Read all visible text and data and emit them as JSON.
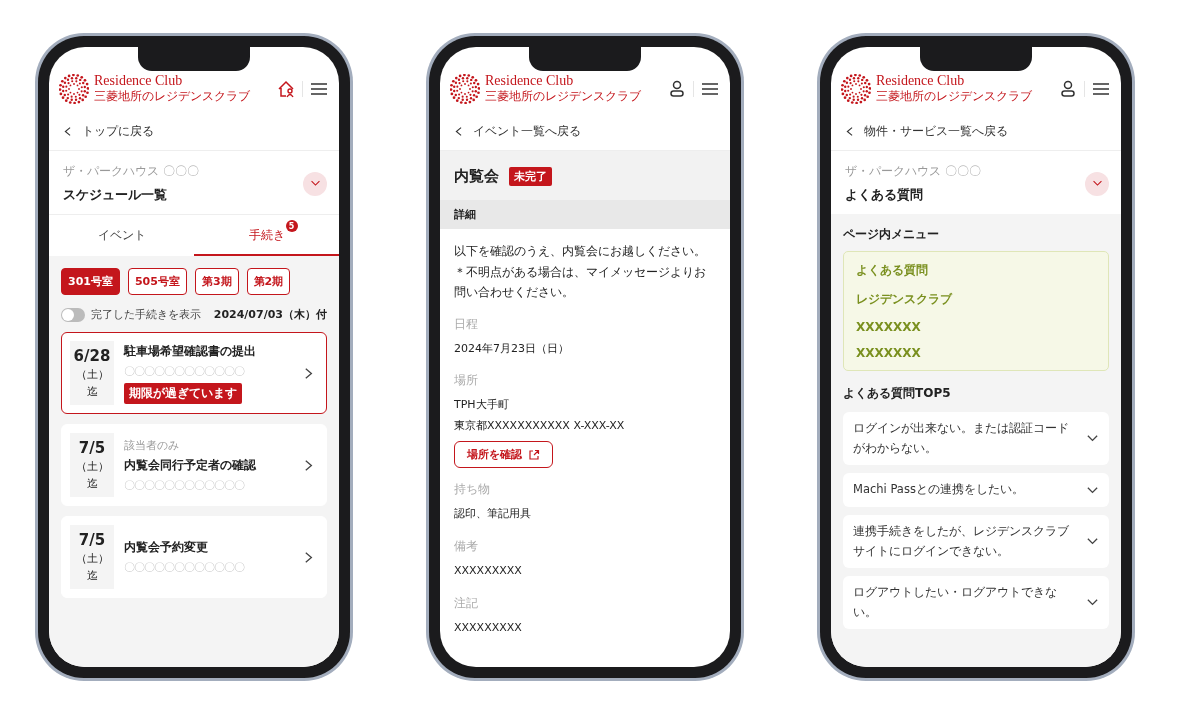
{
  "schedule_screen": {
    "brand": {
      "name": "Residence Club",
      "subtitle": "三菱地所のレジデンスクラブ"
    },
    "back_link": "トップに戻る",
    "property": "ザ・パークハウス 〇〇〇",
    "title": "スケジュール一覧",
    "expanded": false,
    "tabs": [
      {
        "label": "イベント",
        "selected": false
      },
      {
        "label": "手続き",
        "selected": true,
        "badge": "5"
      }
    ],
    "filters": [
      {
        "label": "301号室",
        "selected": true
      },
      {
        "label": "505号室",
        "selected": false
      },
      {
        "label": "第3期",
        "selected": false
      },
      {
        "label": "第2期",
        "selected": false
      }
    ],
    "show_completed": {
      "label": "完了した手続きを表示",
      "on": false
    },
    "as_of": "2024/07/03（木）付",
    "tasks": [
      {
        "date": "6/28",
        "weekday": "（土）",
        "until": "迄",
        "title": "駐車場希望確認書の提出",
        "detail": "〇〇〇〇〇〇〇〇〇〇〇〇",
        "overdue": true,
        "alert": "期限が過ぎています"
      },
      {
        "date": "7/5",
        "weekday": "（土）",
        "until": "迄",
        "note": "該当者のみ",
        "title": "内覧会同行予定者の確認",
        "detail": "〇〇〇〇〇〇〇〇〇〇〇〇",
        "overdue": false
      },
      {
        "date": "7/5",
        "weekday": "（土）",
        "until": "迄",
        "title": "内覧会予約変更",
        "detail": "〇〇〇〇〇〇〇〇〇〇〇〇",
        "overdue": false
      }
    ]
  },
  "event_screen": {
    "brand": {
      "name": "Residence Club",
      "subtitle": "三菱地所のレジデンスクラブ"
    },
    "back_link": "イベント一覧へ戻る",
    "title": "内覧会",
    "status": "未完了",
    "section": "詳細",
    "intro": [
      "以下を確認のうえ、内覧会にお越しください。",
      "＊不明点がある場合は、マイメッセージよりお問い合わせください。"
    ],
    "fields": [
      {
        "label": "日程",
        "lines": [
          "2024年7月23日（日）"
        ]
      },
      {
        "label": "場所",
        "lines": [
          "TPH大手町",
          "東京都XXXXXXXXXXX X-XXX-XX"
        ],
        "button": "場所を確認"
      },
      {
        "label": "持ち物",
        "lines": [
          "認印、筆記用具"
        ]
      },
      {
        "label": "備考",
        "lines": [
          "XXXXXXXXX"
        ]
      },
      {
        "label": "注記",
        "lines": [
          "XXXXXXXXX"
        ]
      }
    ]
  },
  "faq_screen": {
    "brand": {
      "name": "Residence Club",
      "subtitle": "三菱地所のレジデンスクラブ"
    },
    "back_link": "物件・サービス一覧へ戻る",
    "property": "ザ・パークハウス 〇〇〇",
    "title": "よくある質問",
    "expanded": false,
    "menu_label": "ページ内メニュー",
    "menu_items": [
      "よくある質問",
      "レジデンスクラブ",
      "XXXXXXX",
      "XXXXXXX"
    ],
    "top_heading": "よくある質問TOP5",
    "questions": [
      {
        "text": "ログインが出来ない。または認証コードがわからない。",
        "expanded": false
      },
      {
        "text": "Machi Passとの連携をしたい。",
        "expanded": false
      },
      {
        "text": "連携手続きをしたが、レジデンスクラブサイトにログインできない。",
        "expanded": false
      },
      {
        "text": "ログアウトしたい・ログアウトできない。",
        "expanded": false
      }
    ]
  }
}
